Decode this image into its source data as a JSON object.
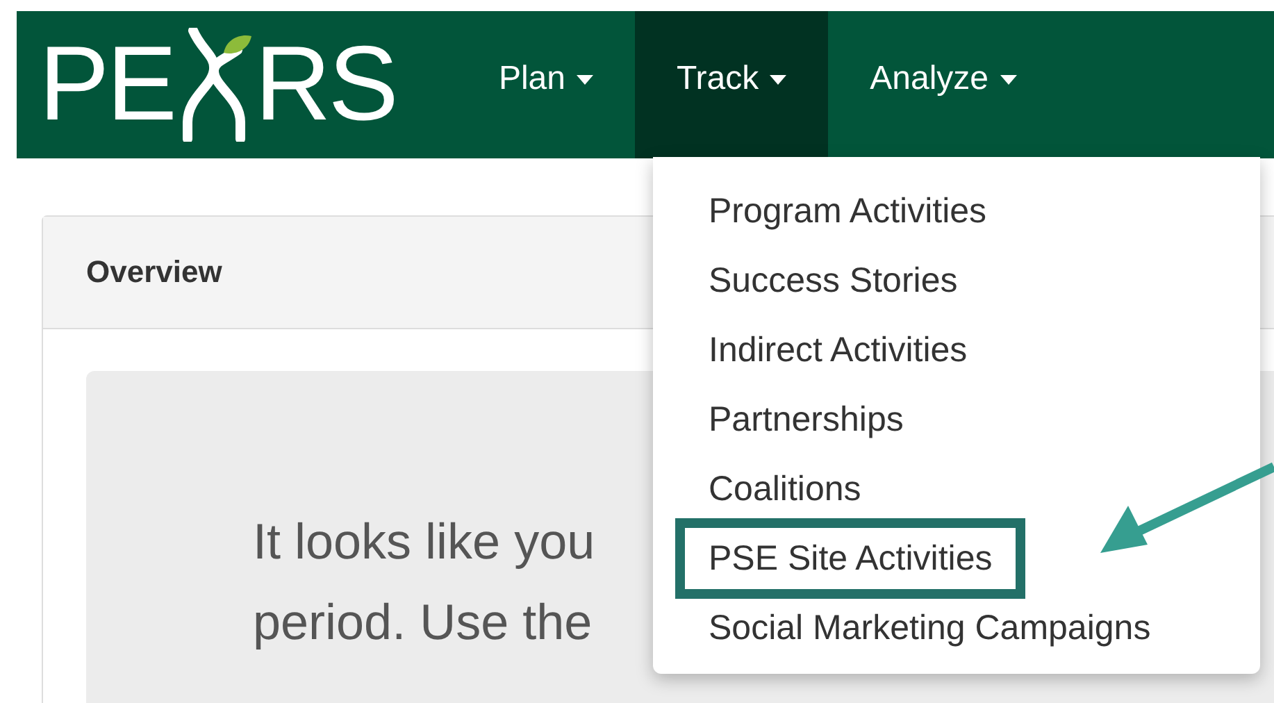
{
  "logo": {
    "text_left": "PE",
    "text_right": "RS"
  },
  "nav": [
    {
      "label": "Plan",
      "selected": false
    },
    {
      "label": "Track",
      "selected": true
    },
    {
      "label": "Analyze",
      "selected": false
    }
  ],
  "dropdown": {
    "items": [
      {
        "label": "Program Activities",
        "highlighted": false
      },
      {
        "label": "Success Stories",
        "highlighted": false
      },
      {
        "label": "Indirect Activities",
        "highlighted": false
      },
      {
        "label": "Partnerships",
        "highlighted": false
      },
      {
        "label": "Coalitions",
        "highlighted": false
      },
      {
        "label": "PSE Site Activities",
        "highlighted": true
      },
      {
        "label": "Social Marketing Campaigns",
        "highlighted": false
      }
    ]
  },
  "panel": {
    "title": "Overview",
    "message_lines": [
      "It looks like you",
      "period. Use the"
    ]
  }
}
